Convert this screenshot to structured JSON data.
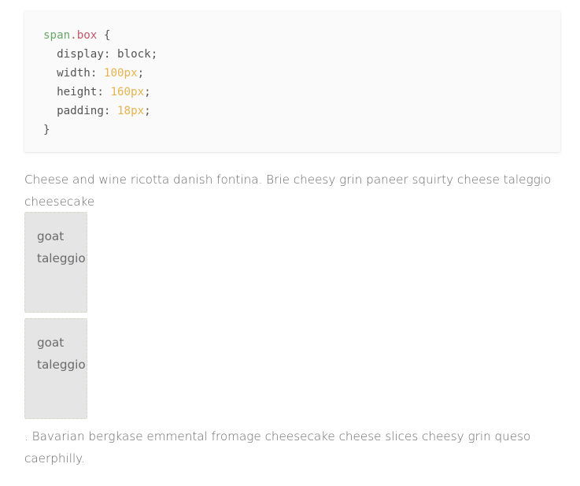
{
  "code_block": {
    "line1": {
      "selector": "span",
      "class_part": ".box",
      "brace_open": " {"
    },
    "line2": {
      "property": "display",
      "value": "block"
    },
    "line3": {
      "property": "width",
      "value": "100px"
    },
    "line4": {
      "property": "height",
      "value": "160px"
    },
    "line5": {
      "property": "padding",
      "value": "18px"
    },
    "line6": {
      "brace_close": "}"
    }
  },
  "paragraph_before": "Cheese and wine ricotta danish fontina. Brie cheesy grin paneer squirty cheese taleggio cheesecake",
  "boxes": [
    {
      "word1": "goat",
      "word2": "taleggio"
    },
    {
      "word1": "goat",
      "word2": "taleggio"
    }
  ],
  "paragraph_after": ". Bavarian bergkase emmental fromage cheesecake cheese slices cheesy grin queso caerphilly.",
  "colors": {
    "selector": "#6aa86a",
    "class": "#c75469",
    "value": "#e8b34c",
    "box_background": "#e5e5e5"
  }
}
